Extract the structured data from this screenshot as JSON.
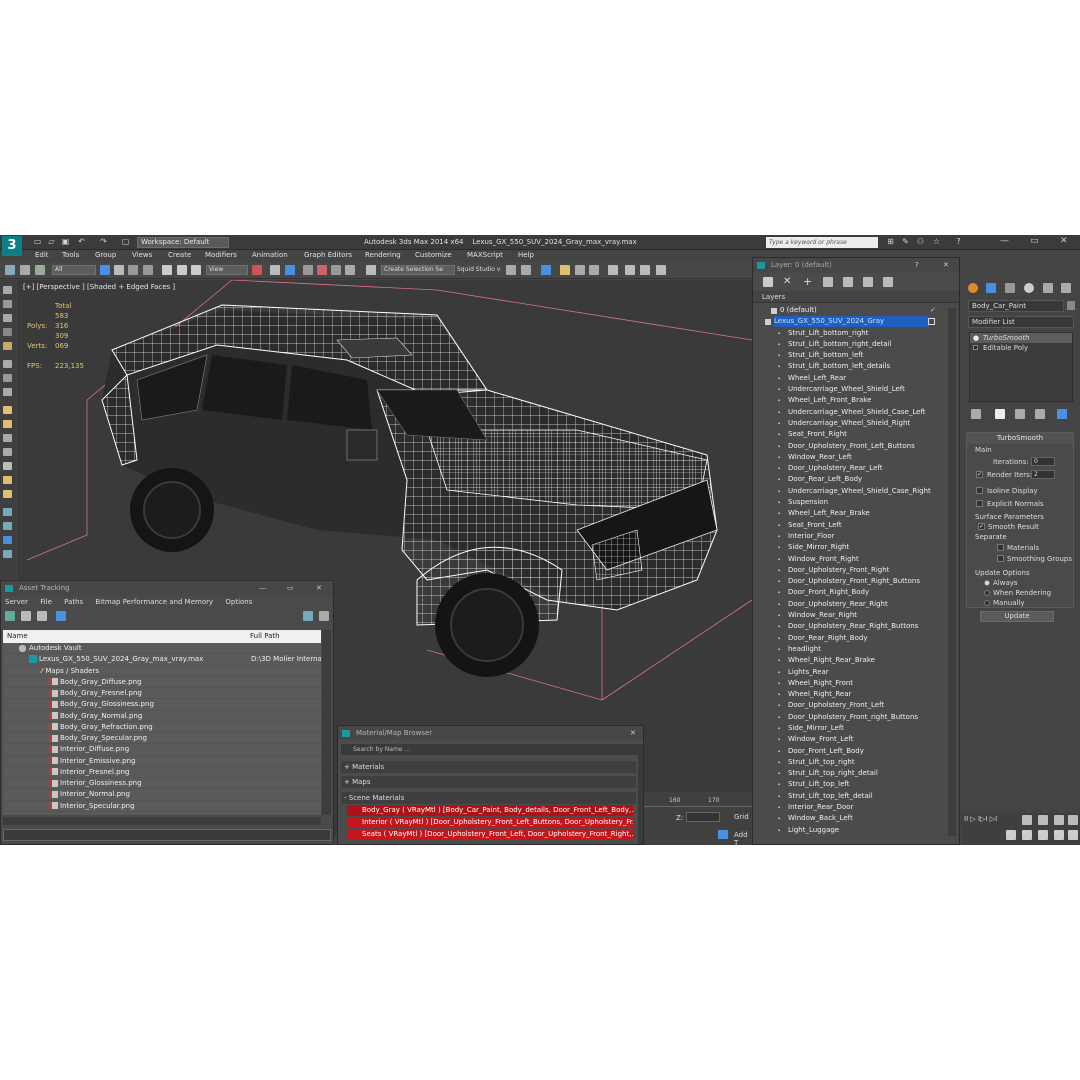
{
  "titlebar": {
    "workspace": "Workspace: Default",
    "app": "Autodesk 3ds Max  2014 x64",
    "file": "Lexus_GX_550_SUV_2024_Gray_max_vray.max",
    "search_placeholder": "Type a keyword or phrase"
  },
  "menu": [
    "Edit",
    "Tools",
    "Group",
    "Views",
    "Create",
    "Modifiers",
    "Animation",
    "Graph Editors",
    "Rendering",
    "Customize",
    "MAXScript",
    "Help"
  ],
  "toolbar": {
    "filter": "All",
    "ref_coord": "View",
    "selection_set": "Create Selection Se",
    "squid": "Squid Studio v"
  },
  "viewport": {
    "label": "[+] [Perspective ] [Shaded + Edged Faces ]",
    "stats_total": "Total",
    "polys_label": "Polys:",
    "polys_value": "583 316",
    "verts_label": "Verts:",
    "verts_value": "309 069",
    "fps_label": "FPS:",
    "fps_value": "223,135"
  },
  "asset_tracking": {
    "title": "Asset Tracking",
    "menu": [
      "Server",
      "File",
      "Paths",
      "Bitmap Performance and Memory",
      "Options"
    ],
    "col_name": "Name",
    "col_path": "Full Path",
    "vault": "Autodesk Vault",
    "max_file": "Lexus_GX_550_SUV_2024_Gray_max_vray.max",
    "max_path": "D:\\3D Molier Internat",
    "folder": "Maps / Shaders",
    "files": [
      "Body_Gray_Diffuse.png",
      "Body_Gray_Fresnel.png",
      "Body_Gray_Glossiness.png",
      "Body_Gray_Normal.png",
      "Body_Gray_Refraction.png",
      "Body_Gray_Specular.png",
      "Interior_Diffuse.png",
      "Interior_Emissive.png",
      "Interior_Fresnel.png",
      "Interior_Glossiness.png",
      "Interior_Normal.png",
      "Interior_Specular.png"
    ]
  },
  "material_browser": {
    "title": "Material/Map Browser",
    "search": "Search by Name ...",
    "sections": [
      "+ Materials",
      "+ Maps",
      "- Scene Materials"
    ],
    "materials": [
      "Body_Gray  ( VRayMtl ) [Body_Car_Paint, Body_details, Door_Front_Left_Body,...",
      "Interior ( VRayMtl ) [Door_Upholstery_Front_Left_Buttons, Door_Upholstery_Fr...",
      "Seats ( VRayMtl ) [Door_Upholstery_Front_Left, Door_Upholstery_Front_Right,..."
    ]
  },
  "layers": {
    "title": "Layer: 0 (default)",
    "header": "Layers",
    "default_layer": "0 (default)",
    "active_layer": "Lexus_GX_550_SUV_2024_Gray",
    "items": [
      "Strut_Lift_bottom_right",
      "Strut_Lift_bottom_right_detail",
      "Strut_Lift_bottom_left",
      "Strut_Lift_bottom_left_details",
      "Wheel_Left_Rear",
      "Undercarriage_Wheel_Shield_Left",
      "Wheel_Left_Front_Brake",
      "Undercarriage_Wheel_Shield_Case_Left",
      "Undercarriage_Wheel_Shield_Right",
      "Seat_Front_Right",
      "Door_Upholstery_Front_Left_Buttons",
      "Window_Rear_Left",
      "Door_Upholstery_Rear_Left",
      "Door_Rear_Left_Body",
      "Undercarriage_Wheel_Shield_Case_Right",
      "Suspension",
      "Wheel_Left_Rear_Brake",
      "Seat_Front_Left",
      "Interior_Floor",
      "Side_Mirror_Right",
      "Window_Front_Right",
      "Door_Upholstery_Front_Right",
      "Door_Upholstery_Front_Right_Buttons",
      "Door_Front_Right_Body",
      "Door_Upholstery_Rear_Right",
      "Window_Rear_Right",
      "Door_Upholstery_Rear_Right_Buttons",
      "Door_Rear_Right_Body",
      "headlight",
      "Wheel_Right_Rear_Brake",
      "Lights_Rear",
      "Wheel_Right_Front",
      "Wheel_Right_Rear",
      "Door_Upholstery_Front_Left",
      "Door_Upholstery_Front_right_Buttons",
      "Side_Mirror_Left",
      "Window_Front_Left",
      "Door_Front_Left_Body",
      "Strut_Lift_top_right",
      "Strut_Lift_top_right_detail",
      "Strut_Lift_top_left",
      "Strut_Lift_top_left_detail",
      "Interior_Rear_Door",
      "Window_Back_Left",
      "Light_Luggage"
    ]
  },
  "command_panel": {
    "object_name": "Body_Car_Paint",
    "modifier_list": "Modifier List",
    "stack": [
      "TurboSmooth",
      "Editable Poly"
    ],
    "rollout_title": "TurboSmooth",
    "main": "Main",
    "iterations_label": "Iterations:",
    "iterations_value": "0",
    "render_iters_label": "Render Iters:",
    "render_iters_value": "2",
    "isoline": "Isoline Display",
    "explicit": "Explicit Normals",
    "surface_params": "Surface Parameters",
    "smooth_result": "Smooth Result",
    "separate": "Separate",
    "materials": "Materials",
    "smoothing_groups": "Smoothing Groups",
    "update_options": "Update Options",
    "always": "Always",
    "when_rendering": "When Rendering",
    "manually": "Manually",
    "update_button": "Update"
  },
  "statusbar": {
    "ruler_marks": [
      "160",
      "170"
    ],
    "z_label": "Z:",
    "grid": "Grid",
    "add_t": "Add T"
  }
}
